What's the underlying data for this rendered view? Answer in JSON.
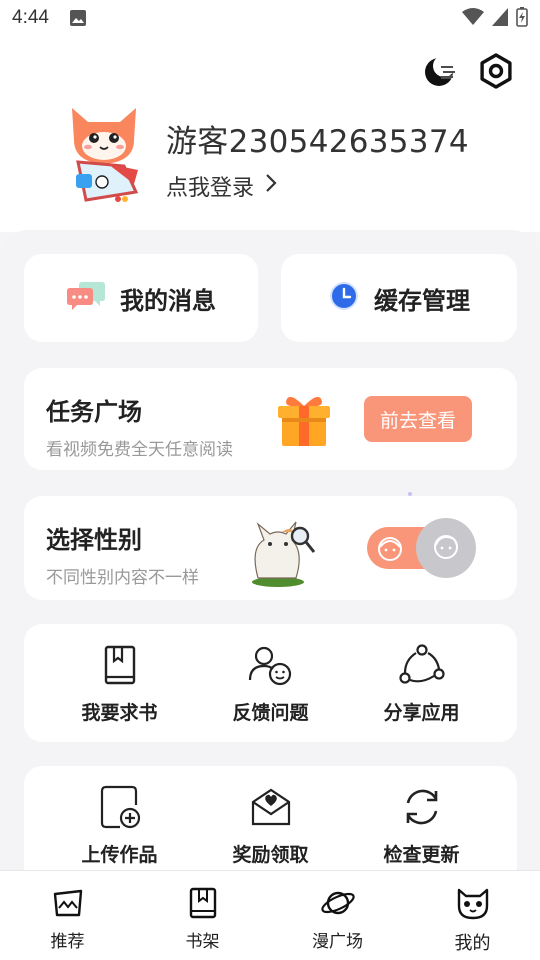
{
  "status": {
    "time": "4:44"
  },
  "profile": {
    "username": "游客230542635374",
    "login_label": "点我登录"
  },
  "quick": {
    "messages_label": "我的消息",
    "cache_label": "缓存管理"
  },
  "task": {
    "title": "任务广场",
    "subtitle": "看视频免费全天任意阅读",
    "button_label": "前去查看"
  },
  "gender": {
    "title": "选择性别",
    "subtitle": "不同性别内容不一样"
  },
  "tools_row1": [
    {
      "label": "我要求书",
      "icon": "book-icon"
    },
    {
      "label": "反馈问题",
      "icon": "feedback-user-icon"
    },
    {
      "label": "分享应用",
      "icon": "share-icon"
    }
  ],
  "tools_row2": [
    {
      "label": "上传作品",
      "icon": "upload-doc-icon"
    },
    {
      "label": "奖励领取",
      "icon": "reward-envelope-icon"
    },
    {
      "label": "检查更新",
      "icon": "refresh-icon"
    }
  ],
  "nav": [
    {
      "label": "推荐",
      "icon": "recommend-icon"
    },
    {
      "label": "书架",
      "icon": "bookshelf-icon"
    },
    {
      "label": "漫广场",
      "icon": "planet-icon"
    },
    {
      "label": "我的",
      "icon": "cat-face-icon"
    }
  ],
  "colors": {
    "accent": "#f9967a",
    "cache_blue": "#2f6be8",
    "gift_orange": "#ffa724"
  }
}
